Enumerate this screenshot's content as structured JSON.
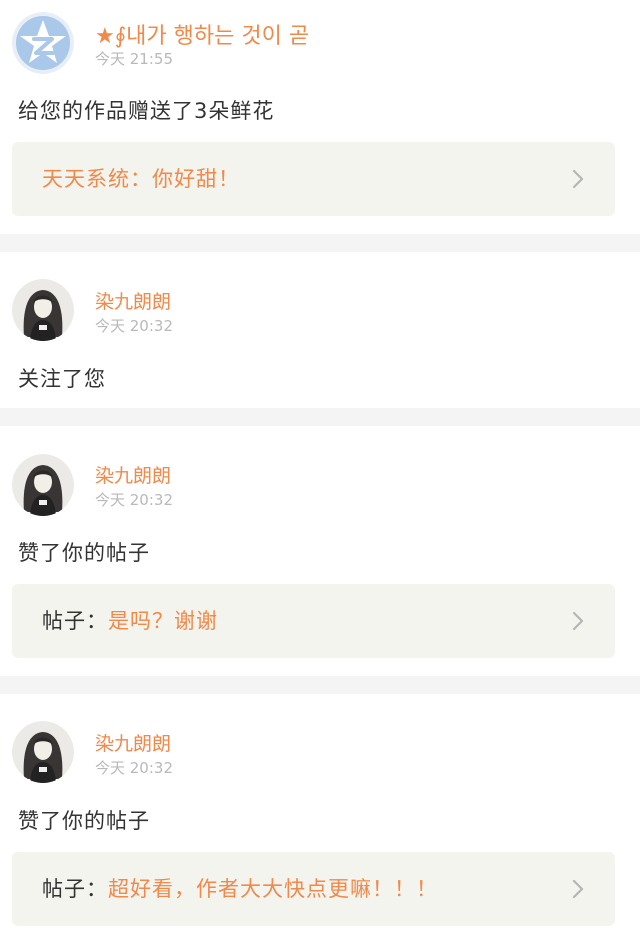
{
  "notifications": [
    {
      "user": "★∮내가 행하는 것이 곧",
      "time": "今天 21:55",
      "action": "给您的作品赠送了3朵鲜花",
      "quote": {
        "label": "",
        "text": "天天系统：你好甜！"
      },
      "avatar_icon": "qzone-logo-icon"
    },
    {
      "user": "染九朗朗",
      "time": "今天 20:32",
      "action": "关注了您",
      "avatar_icon": "anime-girl-avatar"
    },
    {
      "user": "染九朗朗",
      "time": "今天 20:32",
      "action": "赞了你的帖子",
      "quote": {
        "label": "帖子：",
        "text": "是吗？谢谢"
      },
      "avatar_icon": "anime-girl-avatar"
    },
    {
      "user": "染九朗朗",
      "time": "今天 20:32",
      "action": "赞了你的帖子",
      "quote": {
        "label": "帖子：",
        "text": "超好看，作者大大快点更嘛！！！"
      },
      "avatar_icon": "anime-girl-avatar"
    }
  ],
  "colors": {
    "accent": "#f0894a",
    "text": "#333333",
    "time": "#b9b9b9",
    "quote_bg": "#f4f4ef",
    "separator": "#f4f4f4",
    "qzone_blue": "#aac8ea"
  }
}
